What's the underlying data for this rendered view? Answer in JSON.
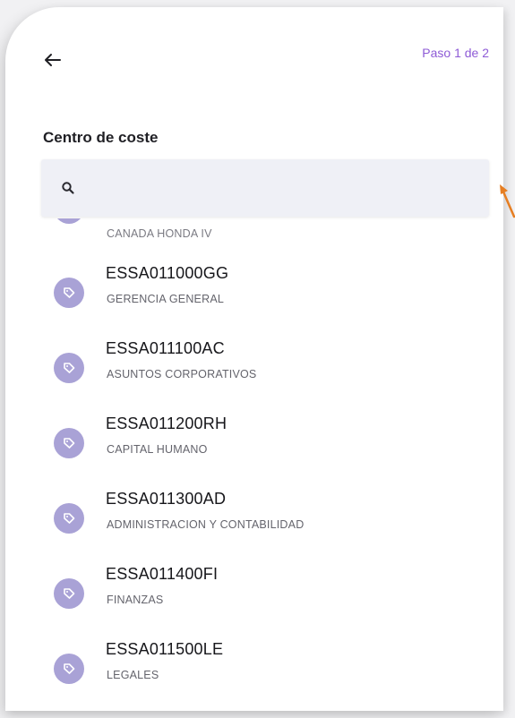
{
  "header": {
    "back_icon": "arrow-left-icon",
    "step_label": "Paso 1 de 2"
  },
  "title": "Centro de coste",
  "search": {
    "value": "",
    "placeholder": "",
    "icon": "search-icon"
  },
  "items": [
    {
      "code": "",
      "description": "CANADA HONDA IV"
    },
    {
      "code": "ESSA011000GG",
      "description": "GERENCIA GENERAL"
    },
    {
      "code": "ESSA011100AC",
      "description": "ASUNTOS CORPORATIVOS"
    },
    {
      "code": "ESSA011200RH",
      "description": "CAPITAL HUMANO"
    },
    {
      "code": "ESSA011300AD",
      "description": "ADMINISTRACION Y CONTABILIDAD"
    },
    {
      "code": "ESSA011400FI",
      "description": "FINANZAS"
    },
    {
      "code": "ESSA011500LE",
      "description": "LEGALES"
    }
  ],
  "colors": {
    "accent": "#8e5bd6",
    "avatar": "#a9a2d6",
    "search_bg": "#eff0f6",
    "pointer_arrow": "#e67e22"
  }
}
